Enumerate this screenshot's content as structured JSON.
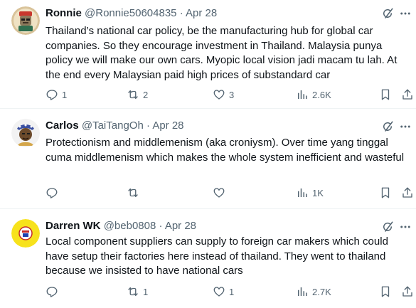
{
  "tweets": [
    {
      "name": "Ronnie",
      "handle": "@Ronnie50604835",
      "sep": "·",
      "date": "Apr 28",
      "text": "Thailand’s national car policy, be the manufacturing hub for global car companies. So they encourage investment in Thailand. Malaysia punya policy we will make our own cars. Myopic local vision jadi macam tu lah. At the end every Malaysian paid high prices of substandard car",
      "replies": "1",
      "reposts": "2",
      "likes": "3",
      "views": "2.6K"
    },
    {
      "name": "Carlos",
      "handle": "@TaiTangOh",
      "sep": "·",
      "date": "Apr 28",
      "text": "Protectionism and middlemenism (aka croniysm). Over time yang tinggal cuma middlemenism which makes the whole system inefficient and wasteful",
      "replies": "",
      "reposts": "",
      "likes": "",
      "views": "1K"
    },
    {
      "name": "Darren WK",
      "handle": "@beb0808",
      "sep": "·",
      "date": "Apr 28",
      "text": "Local component suppliers can supply to foreign car makers which could have setup their factories here instead of thailand. They went to thailand because we insisted to have national cars",
      "replies": "",
      "reposts": "1",
      "likes": "1",
      "views": "2.7K"
    }
  ],
  "colors": {
    "text": "#0f1419",
    "secondary": "#536471",
    "divider": "#eff3f4"
  }
}
